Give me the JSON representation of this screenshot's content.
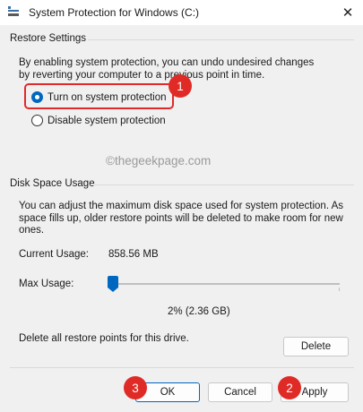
{
  "window": {
    "title": "System Protection for Windows (C:)",
    "app_icon": "system-icon",
    "close_glyph": "✕"
  },
  "restore_settings": {
    "group_title": "Restore Settings",
    "description": "By enabling system protection, you can undo undesired changes by reverting your computer to a previous point in time.",
    "options": [
      {
        "label": "Turn on system protection",
        "selected": true
      },
      {
        "label": "Disable system protection",
        "selected": false
      }
    ]
  },
  "watermark": "©thegeekpage.com",
  "disk_space": {
    "group_title": "Disk Space Usage",
    "description": "You can adjust the maximum disk space used for system protection. As space fills up, older restore points will be deleted to make room for new ones.",
    "current_usage_label": "Current Usage:",
    "current_usage_value": "858.56 MB",
    "max_usage_label": "Max Usage:",
    "max_usage_percent": 2,
    "max_usage_value": "2% (2.36 GB)",
    "delete_text": "Delete all restore points for this drive.",
    "delete_button": "Delete"
  },
  "buttons": {
    "ok": "OK",
    "cancel": "Cancel",
    "apply": "Apply"
  },
  "badges": {
    "one": "1",
    "two": "2",
    "three": "3"
  },
  "colors": {
    "accent": "#0067c0",
    "highlight": "#e0292a",
    "badge": "#e02a26"
  }
}
